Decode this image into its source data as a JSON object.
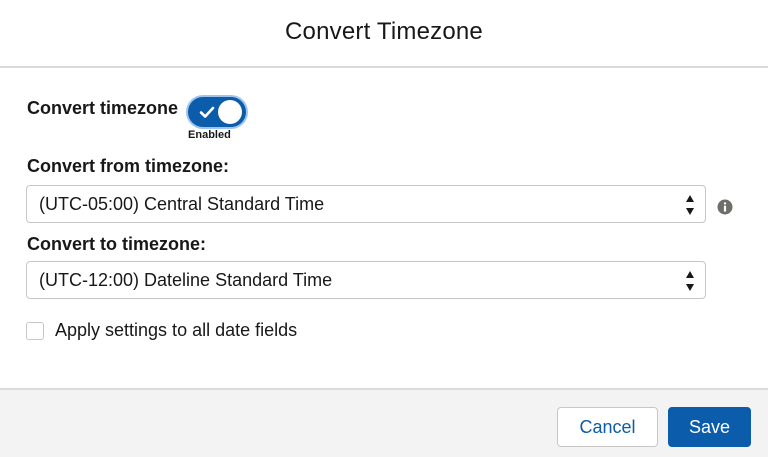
{
  "modal": {
    "title": "Convert Timezone"
  },
  "toggle": {
    "label": "Convert timezone",
    "status": "Enabled",
    "checked": true
  },
  "from": {
    "label": "Convert from timezone:",
    "value": "(UTC-05:00) Central Standard Time"
  },
  "to": {
    "label": "Convert to timezone:",
    "value": "(UTC-12:00) Dateline Standard Time"
  },
  "apply_all": {
    "label": "Apply settings to all date fields",
    "checked": false
  },
  "footer": {
    "cancel_label": "Cancel",
    "save_label": "Save"
  },
  "icons": {
    "info": "info-icon",
    "select_arrows": "up-down-arrows-icon",
    "check": "check-icon"
  },
  "colors": {
    "brand": "#0b5cab",
    "border": "#c9c7c5",
    "footer_bg": "#f3f3f3",
    "divider": "#dddbda"
  }
}
